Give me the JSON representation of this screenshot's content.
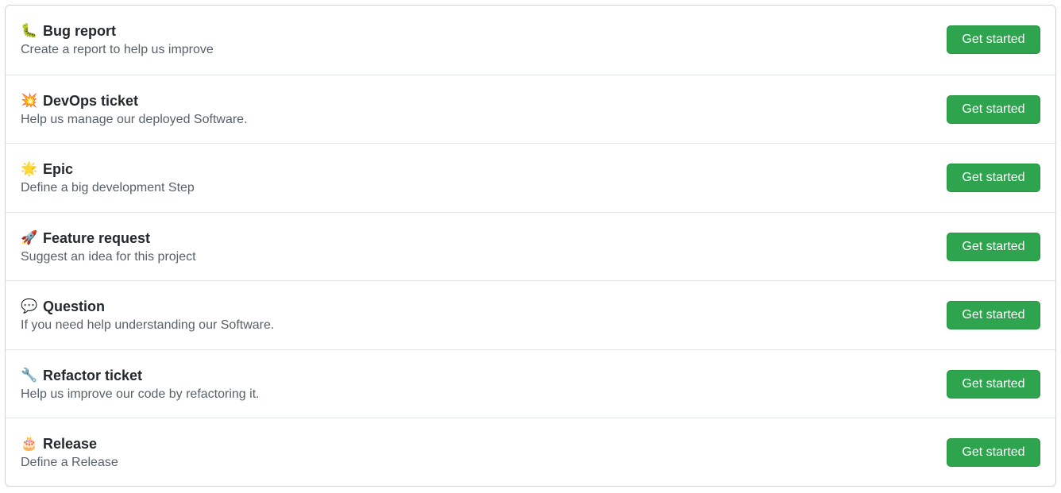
{
  "templates": [
    {
      "emoji": "🐛",
      "icon": "bug-emoji",
      "title": "Bug report",
      "description": "Create a report to help us improve",
      "button": "Get started"
    },
    {
      "emoji": "💥",
      "icon": "collision-emoji",
      "title": "DevOps ticket",
      "description": "Help us manage our deployed Software.",
      "button": "Get started"
    },
    {
      "emoji": "🌟",
      "icon": "glowing-star-emoji",
      "title": "Epic",
      "description": "Define a big development Step",
      "button": "Get started"
    },
    {
      "emoji": "🚀",
      "icon": "rocket-emoji",
      "title": "Feature request",
      "description": "Suggest an idea for this project",
      "button": "Get started"
    },
    {
      "emoji": "💬",
      "icon": "speech-balloon-emoji",
      "title": "Question",
      "description": "If you need help understanding our Software.",
      "button": "Get started"
    },
    {
      "emoji": "🔧",
      "icon": "wrench-emoji",
      "title": "Refactor ticket",
      "description": "Help us improve our code by refactoring it.",
      "button": "Get started"
    },
    {
      "emoji": "🎂",
      "icon": "birthday-cake-emoji",
      "title": "Release",
      "description": "Define a Release",
      "button": "Get started"
    }
  ],
  "colors": {
    "button_bg": "#2ea44f",
    "button_text": "#ffffff",
    "title_text": "#24292e",
    "description_text": "#586069",
    "border": "#d1d5da"
  }
}
